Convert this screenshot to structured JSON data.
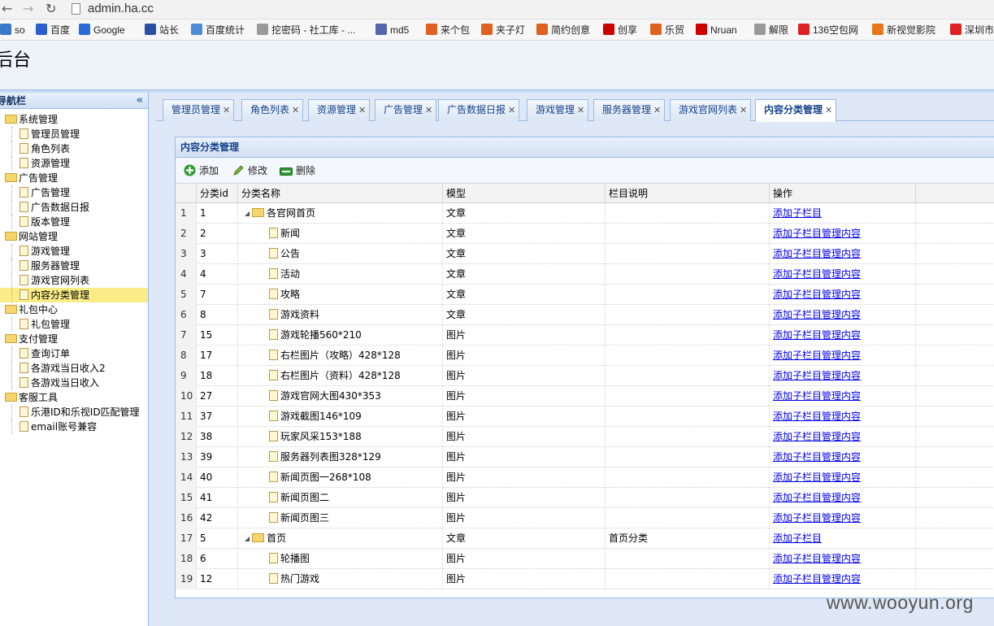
{
  "browser": {
    "url": "admin.ha.cc",
    "bookmarks": [
      "so",
      "百度",
      "Google",
      "站长",
      "百度统计",
      "挖密码 - 社工库 - ...",
      "md5",
      "来个包",
      "夹子灯",
      "简约创意",
      "创享",
      "乐贸",
      "Nruan",
      "解限",
      "136空包网",
      "新视觉影院",
      "深圳市"
    ]
  },
  "app": {
    "title": "后台"
  },
  "sidebar": {
    "title": "导航栏",
    "groups": [
      {
        "label": "系统管理",
        "items": [
          "管理员管理",
          "角色列表",
          "资源管理"
        ]
      },
      {
        "label": "广告管理",
        "items": [
          "广告管理",
          "广告数据日报",
          "版本管理"
        ]
      },
      {
        "label": "网站管理",
        "items": [
          "游戏管理",
          "服务器管理",
          "游戏官网列表",
          "内容分类管理"
        ]
      },
      {
        "label": "礼包中心",
        "items": [
          "礼包管理"
        ]
      },
      {
        "label": "支付管理",
        "items": [
          "查询订单",
          "各游戏当日收入2",
          "各游戏当日收入"
        ]
      },
      {
        "label": "客服工具",
        "items": [
          "乐港ID和乐视ID匹配管理",
          "email账号兼容"
        ]
      }
    ]
  },
  "tabs": [
    "管理员管理",
    "角色列表",
    "资源管理",
    "广告管理",
    "广告数据日报",
    "游戏管理",
    "服务器管理",
    "游戏官网列表",
    "内容分类管理"
  ],
  "panel": {
    "title": "内容分类管理",
    "toolbar": {
      "add": "添加",
      "edit": "修改",
      "delete": "删除"
    },
    "columns": [
      "分类id",
      "分类名称",
      "模型",
      "栏目说明",
      "操作"
    ],
    "actions": {
      "add_child": "添加子栏目",
      "manage": "管理内容"
    },
    "rows": [
      {
        "n": "1",
        "id": "1",
        "name": "各官网首页",
        "model": "文章",
        "desc": "",
        "folder": true,
        "manage": false
      },
      {
        "n": "2",
        "id": "2",
        "name": "新闻",
        "model": "文章",
        "desc": "",
        "folder": false,
        "manage": true
      },
      {
        "n": "3",
        "id": "3",
        "name": "公告",
        "model": "文章",
        "desc": "",
        "folder": false,
        "manage": true
      },
      {
        "n": "4",
        "id": "4",
        "name": "活动",
        "model": "文章",
        "desc": "",
        "folder": false,
        "manage": true
      },
      {
        "n": "5",
        "id": "7",
        "name": "攻略",
        "model": "文章",
        "desc": "",
        "folder": false,
        "manage": true
      },
      {
        "n": "6",
        "id": "8",
        "name": "游戏资料",
        "model": "文章",
        "desc": "",
        "folder": false,
        "manage": true
      },
      {
        "n": "7",
        "id": "15",
        "name": "游戏轮播560*210",
        "model": "图片",
        "desc": "",
        "folder": false,
        "manage": true
      },
      {
        "n": "8",
        "id": "17",
        "name": "右栏图片（攻略）428*128",
        "model": "图片",
        "desc": "",
        "folder": false,
        "manage": true
      },
      {
        "n": "9",
        "id": "18",
        "name": "右栏图片（资料）428*128",
        "model": "图片",
        "desc": "",
        "folder": false,
        "manage": true
      },
      {
        "n": "10",
        "id": "27",
        "name": "游戏官网大图430*353",
        "model": "图片",
        "desc": "",
        "folder": false,
        "manage": true
      },
      {
        "n": "11",
        "id": "37",
        "name": "游戏截图146*109",
        "model": "图片",
        "desc": "",
        "folder": false,
        "manage": true
      },
      {
        "n": "12",
        "id": "38",
        "name": "玩家风采153*188",
        "model": "图片",
        "desc": "",
        "folder": false,
        "manage": true
      },
      {
        "n": "13",
        "id": "39",
        "name": "服务器列表图328*129",
        "model": "图片",
        "desc": "",
        "folder": false,
        "manage": true
      },
      {
        "n": "14",
        "id": "40",
        "name": "新闻页图一268*108",
        "model": "图片",
        "desc": "",
        "folder": false,
        "manage": true
      },
      {
        "n": "15",
        "id": "41",
        "name": "新闻页图二",
        "model": "图片",
        "desc": "",
        "folder": false,
        "manage": true
      },
      {
        "n": "16",
        "id": "42",
        "name": "新闻页图三",
        "model": "图片",
        "desc": "",
        "folder": false,
        "manage": true
      },
      {
        "n": "17",
        "id": "5",
        "name": "首页",
        "model": "文章",
        "desc": "首页分类",
        "folder": true,
        "manage": false
      },
      {
        "n": "18",
        "id": "6",
        "name": "轮播图",
        "model": "图片",
        "desc": "",
        "folder": false,
        "manage": true
      },
      {
        "n": "19",
        "id": "12",
        "name": "热门游戏",
        "model": "图片",
        "desc": "",
        "folder": false,
        "manage": true
      }
    ]
  },
  "watermark": "www.wooyun.org"
}
